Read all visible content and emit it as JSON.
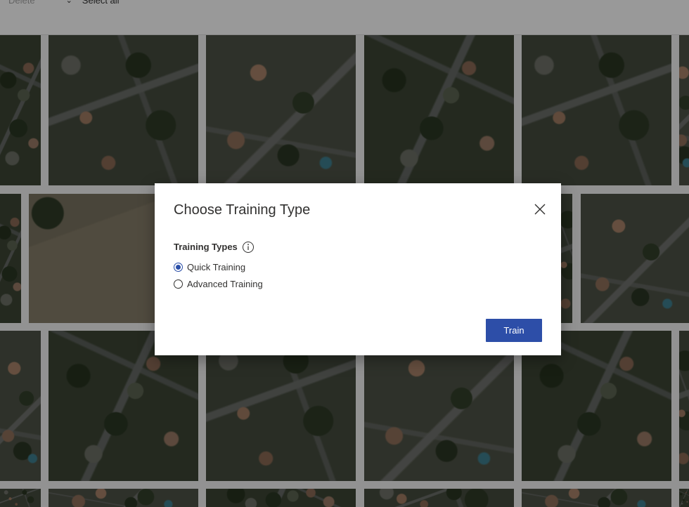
{
  "toolbar": {
    "delete_label": "Delete",
    "select_all_label": "Select all"
  },
  "dialog": {
    "title": "Choose Training Type",
    "field_label": "Training Types",
    "options": [
      {
        "label": "Quick Training",
        "selected": true
      },
      {
        "label": "Advanced Training",
        "selected": false
      }
    ],
    "train_label": "Train",
    "accent_color": "#2d4ea8"
  },
  "icons": {
    "close": "close-icon",
    "info": "info-icon",
    "chevron": "chevron-down-icon"
  }
}
